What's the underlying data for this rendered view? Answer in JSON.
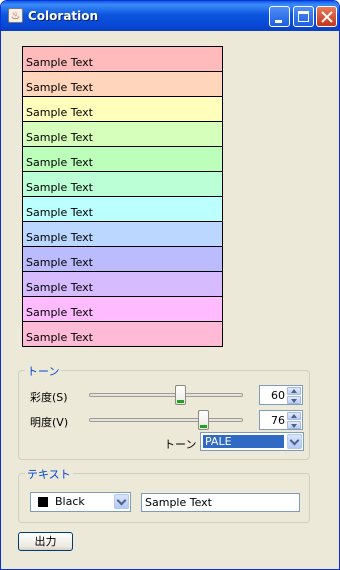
{
  "window": {
    "title": "Coloration"
  },
  "swatches": [
    {
      "text": "Sample Text",
      "color": "#ffbbbb"
    },
    {
      "text": "Sample Text",
      "color": "#ffd6bb"
    },
    {
      "text": "Sample Text",
      "color": "#ffffbb"
    },
    {
      "text": "Sample Text",
      "color": "#d6ffbb"
    },
    {
      "text": "Sample Text",
      "color": "#bbffbb"
    },
    {
      "text": "Sample Text",
      "color": "#bbffd6"
    },
    {
      "text": "Sample Text",
      "color": "#bbffff"
    },
    {
      "text": "Sample Text",
      "color": "#bbd6ff"
    },
    {
      "text": "Sample Text",
      "color": "#bbbbff"
    },
    {
      "text": "Sample Text",
      "color": "#d6bbff"
    },
    {
      "text": "Sample Text",
      "color": "#ffbbff"
    },
    {
      "text": "Sample Text",
      "color": "#ffbbd6"
    }
  ],
  "tone_group": {
    "label": "トーン",
    "saturation": {
      "label": "彩度(S)",
      "value": "60",
      "level": 0.6
    },
    "brightness": {
      "label": "明度(V)",
      "value": "76",
      "level": 0.76
    },
    "tone": {
      "label": "トーン",
      "selected": "PALE"
    }
  },
  "text_group": {
    "label": "テキスト",
    "color": {
      "selected": "Black",
      "swatch": "#000000"
    },
    "text_value": "Sample Text"
  },
  "output_button": "出力"
}
